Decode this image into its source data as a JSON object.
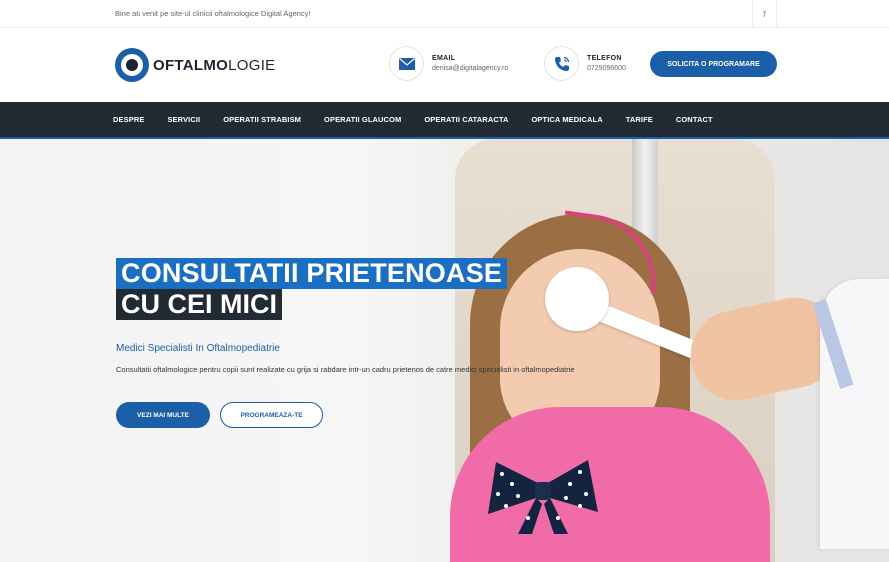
{
  "topbar": {
    "welcome": "Bine ati venit pe site-ul clinicii oftalmologice Digital Agency!",
    "facebook_glyph": "f"
  },
  "header": {
    "logo_bold": "OFTALMO",
    "logo_light": "LOGIE",
    "email": {
      "label": "EMAIL",
      "value": "denisa@digitalagency.ro",
      "icon": "envelope-icon"
    },
    "phone": {
      "label": "TELEFON",
      "value": "0729096600",
      "icon": "phone-icon"
    },
    "cta": "SOLICITA O PROGRAMARE"
  },
  "nav": {
    "items": [
      "DESPRE",
      "SERVICII",
      "OPERATII STRABISM",
      "OPERATII GLAUCOM",
      "OPERATII CATARACTA",
      "OPTICA MEDICALA",
      "TARIFE",
      "CONTACT"
    ]
  },
  "hero": {
    "title_line1": "CONSULTATII PRIETENOASE",
    "title_line2": "CU CEI MICI",
    "subtitle": "Medici Specialisti In Oftalmopediatrie",
    "description": "Consultatii oftalmologice pentru copii sunt realizate cu grija si rabdare intr-un cadru prietenos de catre medici specialisti in oftalmopediatrie",
    "btn_more": "VEZI MAI MULTE",
    "btn_book": "PROGRAMEAZA-TE"
  },
  "colors": {
    "brand": "#1b5fa8",
    "title_highlight": "#1b6fc2",
    "nav_bg": "#222a33"
  }
}
